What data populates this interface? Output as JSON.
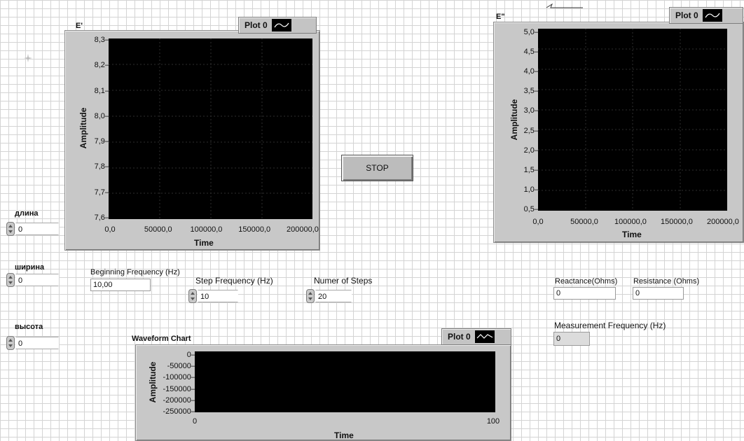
{
  "graph_e1": {
    "title": "E'",
    "legend": "Plot 0",
    "ylabel": "Amplitude",
    "xlabel": "Time",
    "yticks": [
      "8,3",
      "8,2",
      "8,1",
      "8,0",
      "7,9",
      "7,8",
      "7,7",
      "7,6"
    ],
    "xticks": [
      "0,0",
      "50000,0",
      "100000,0",
      "150000,0",
      "200000,0"
    ]
  },
  "graph_e2": {
    "title": "E\"",
    "legend": "Plot 0",
    "ylabel": "Amplitude",
    "xlabel": "Time",
    "yticks": [
      "5,0",
      "4,5",
      "4,0",
      "3,5",
      "3,0",
      "2,5",
      "2,0",
      "1,5",
      "1,0",
      "0,5"
    ],
    "xticks": [
      "0,0",
      "50000,0",
      "100000,0",
      "150000,0",
      "200000,0"
    ]
  },
  "stop_button": "STOP",
  "controls": {
    "length_label": "длина",
    "length_value": "0",
    "width_label": "ширина",
    "width_value": "0",
    "height_label": "высота",
    "height_value": "0"
  },
  "params": {
    "begin_freq_label": "Beginning Frequency (Hz)",
    "begin_freq_value": "10,00",
    "step_freq_label": "Step Frequency (Hz)",
    "step_freq_value": "10",
    "num_steps_label": "Numer of Steps",
    "num_steps_value": "20"
  },
  "results": {
    "reactance_label": "Reactance(Ohms)",
    "reactance_value": "0",
    "resistance_label": "Resistance (Ohms)",
    "resistance_value": "0",
    "meas_freq_label": "Measurement Frequency (Hz)",
    "meas_freq_value": "0"
  },
  "waveform": {
    "title": "Waveform Chart",
    "legend": "Plot 0",
    "ylabel": "Amplitude",
    "xlabel": "Time",
    "yticks": [
      "0",
      "-50000",
      "-100000",
      "-150000",
      "-200000",
      "-250000"
    ],
    "xticks": [
      "0",
      "100"
    ]
  },
  "colors": {
    "plot_bg": "#000000",
    "panel": "#c8c8c8"
  }
}
